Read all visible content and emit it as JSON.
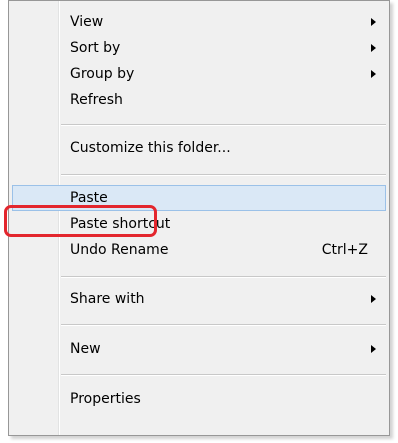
{
  "context_menu": {
    "items": [
      {
        "label": "View",
        "submenu": true
      },
      {
        "label": "Sort by",
        "submenu": true
      },
      {
        "label": "Group by",
        "submenu": true
      },
      {
        "label": "Refresh"
      },
      {
        "label": "Customize this folder..."
      },
      {
        "label": "Paste",
        "highlighted": true
      },
      {
        "label": "Paste shortcut"
      },
      {
        "label": "Undo Rename",
        "shortcut": "Ctrl+Z"
      },
      {
        "label": "Share with",
        "submenu": true
      },
      {
        "label": "New",
        "submenu": true
      },
      {
        "label": "Properties"
      }
    ]
  },
  "annotation": {
    "color": "#e3262d",
    "target": "Paste"
  },
  "colors": {
    "menu_background": "#f0f0f0",
    "highlight_background": "#dae8f6",
    "highlight_border": "#9bc1e8"
  }
}
